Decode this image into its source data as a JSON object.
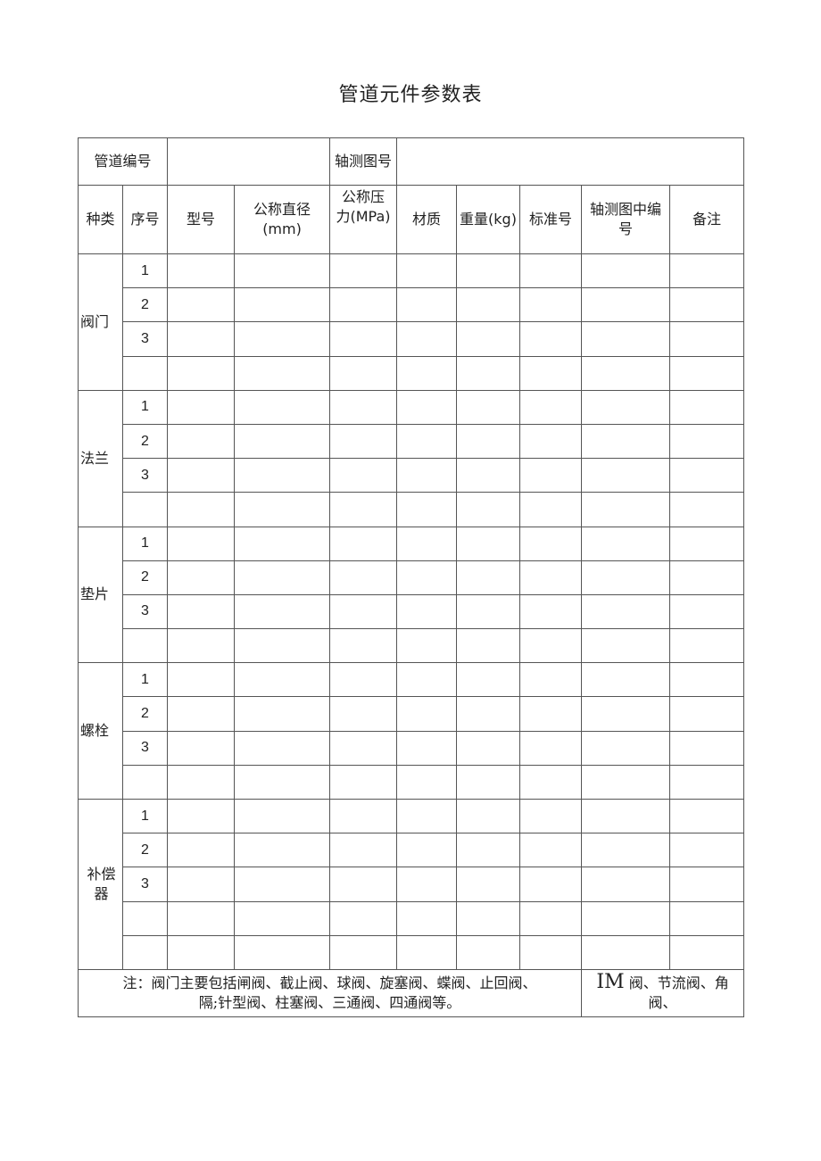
{
  "title": "管道元件参数表",
  "header": {
    "pipe_no_label": "管道编号",
    "pipe_no_value": "",
    "iso_drawing_label": "轴测图号",
    "iso_drawing_value": ""
  },
  "columns": [
    "种类",
    "序号",
    "型号",
    "公称直径(mm)",
    "公称压力(MPa)",
    "材质",
    "重量(kg)",
    "标准号",
    "轴测图中编号",
    "备注"
  ],
  "column_labels": {
    "kind": "种类",
    "seq": "序号",
    "model": "型号",
    "dn_line1": "公称直径",
    "dn_line2": "(mm)",
    "pn_line1": "公称压",
    "pn_line2": "力(MPa)",
    "material": "材质",
    "weight": "重量(kg)",
    "standard": "标准号",
    "iso_no_line1": "轴测图中编",
    "iso_no_line2": "号",
    "remark": "备注"
  },
  "groups": [
    {
      "name": "阀门",
      "rows": [
        "1",
        "2",
        "3",
        ""
      ]
    },
    {
      "name": "法兰",
      "rows": [
        "1",
        "2",
        "3",
        ""
      ]
    },
    {
      "name": "垫片",
      "rows": [
        "1",
        "2",
        "3",
        ""
      ]
    },
    {
      "name": "螺栓",
      "rows": [
        "1",
        "2",
        "3",
        ""
      ]
    },
    {
      "name_line1": "补偿",
      "name_line2": "器",
      "name": "补偿器",
      "rows": [
        "1",
        "2",
        "3",
        "",
        ""
      ]
    }
  ],
  "note": {
    "left_line1": "注：阀门主要包括闸阀、截止阀、球阀、旋塞阀、蝶阀、止回阀、",
    "left_line2": "隔;针型阀、柱塞阀、三通阀、四通阀等。",
    "right_prefix": "IM",
    "right_line1_rest": " 阀、节流阀、角",
    "right_line2": "阀、"
  }
}
